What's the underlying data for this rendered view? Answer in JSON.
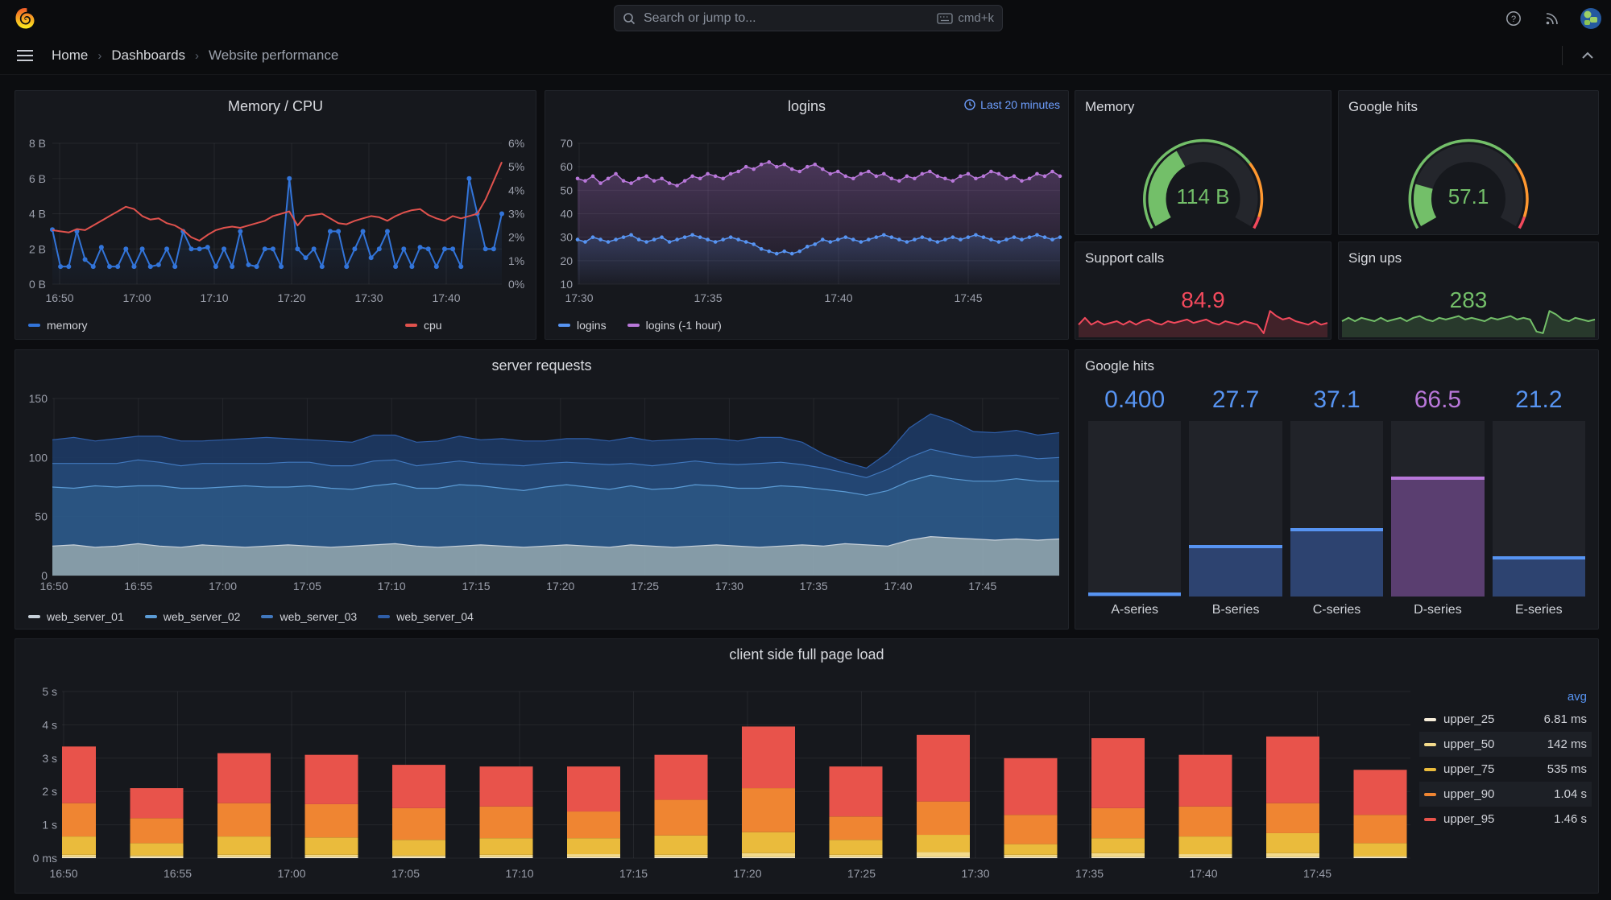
{
  "topbar": {
    "search_placeholder": "Search or jump to...",
    "shortcut": "cmd+k"
  },
  "breadcrumb": {
    "items": [
      "Home",
      "Dashboards",
      "Website performance"
    ]
  },
  "panels": {
    "memory_cpu": {
      "title": "Memory / CPU",
      "legend": [
        "memory",
        "cpu"
      ]
    },
    "logins": {
      "title": "logins",
      "time_range": "Last 20 minutes",
      "legend": [
        "logins",
        "logins (-1 hour)"
      ]
    },
    "memory_gauge": {
      "title": "Memory",
      "value": "114 B"
    },
    "google_gauge": {
      "title": "Google hits",
      "value": "57.1"
    },
    "support_calls": {
      "title": "Support calls",
      "value": "84.9"
    },
    "sign_ups": {
      "title": "Sign ups",
      "value": "283"
    },
    "server_requests": {
      "title": "server requests",
      "legend": [
        "web_server_01",
        "web_server_02",
        "web_server_03",
        "web_server_04"
      ]
    },
    "google_bars": {
      "title": "Google hits"
    },
    "client_load": {
      "title": "client side full page load",
      "legend_header": "avg"
    }
  },
  "chart_data": [
    {
      "id": "memory_cpu",
      "type": "line",
      "title": "Memory / CPU",
      "y_left_labels": [
        "8 B",
        "6 B",
        "4 B",
        "2 B",
        "0 B"
      ],
      "y_right_labels": [
        "6%",
        "5%",
        "4%",
        "3%",
        "2%",
        "1%",
        "0%"
      ],
      "x_ticks": [
        "16:50",
        "17:00",
        "17:10",
        "17:20",
        "17:30",
        "17:40"
      ],
      "ylim_left": [
        0,
        8
      ],
      "ylim_right": [
        0,
        6
      ],
      "series": [
        {
          "name": "memory",
          "axis": "left",
          "color": "#3274D9",
          "show_points": true,
          "values": [
            3.1,
            1,
            1,
            3,
            1.4,
            1,
            2.1,
            1,
            1,
            2,
            1,
            2,
            1,
            1.1,
            2,
            1,
            3,
            2,
            2,
            2.1,
            1,
            2,
            1,
            3,
            1.1,
            1,
            2,
            2,
            1,
            6,
            2,
            1.5,
            2,
            1,
            3,
            3,
            1,
            2,
            3,
            1.5,
            2,
            3,
            1,
            2,
            1,
            2.1,
            2,
            1,
            2,
            2,
            1,
            6,
            4,
            2,
            2,
            4
          ]
        },
        {
          "name": "cpu",
          "axis": "right",
          "color": "#E0524D",
          "show_points": false,
          "values": [
            2.3,
            2.25,
            2.2,
            2.35,
            2.3,
            2.5,
            2.7,
            2.9,
            3.1,
            3.3,
            3.2,
            2.9,
            2.75,
            2.8,
            2.6,
            2.5,
            2.3,
            2.0,
            1.85,
            2.1,
            2.3,
            2.4,
            2.45,
            2.4,
            2.5,
            2.6,
            2.7,
            2.9,
            3.0,
            3.1,
            2.5,
            2.9,
            2.95,
            3.0,
            2.8,
            2.6,
            2.55,
            2.7,
            2.8,
            2.9,
            2.85,
            2.7,
            2.9,
            3.05,
            3.15,
            3.2,
            2.95,
            2.8,
            2.7,
            2.9,
            2.8,
            2.9,
            3.0,
            3.6,
            4.4,
            5.2
          ]
        }
      ]
    },
    {
      "id": "logins",
      "type": "line",
      "title": "logins",
      "x_ticks": [
        "17:30",
        "17:35",
        "17:40",
        "17:45"
      ],
      "y_ticks": [
        70,
        60,
        50,
        40,
        30,
        20,
        10
      ],
      "ylim": [
        10,
        70
      ],
      "series": [
        {
          "name": "logins",
          "color": "#5794F2",
          "values": [
            29,
            28,
            30,
            29,
            28,
            29,
            30,
            31,
            29,
            28,
            29,
            30,
            28,
            29,
            30,
            31,
            30,
            29,
            28,
            29,
            30,
            29,
            28,
            27,
            25,
            24,
            23,
            24,
            23,
            24,
            26,
            27,
            29,
            28,
            29,
            30,
            29,
            28,
            29,
            30,
            31,
            30,
            29,
            28,
            29,
            30,
            29,
            28,
            29,
            30,
            29,
            30,
            31,
            30,
            29,
            28,
            29,
            30,
            29,
            30,
            31,
            30,
            29,
            30
          ]
        },
        {
          "name": "logins (-1 hour)",
          "color": "#B877D9",
          "values": [
            55,
            54,
            56,
            53,
            55,
            57,
            54,
            53,
            55,
            56,
            54,
            55,
            53,
            52,
            54,
            56,
            55,
            57,
            56,
            55,
            57,
            58,
            60,
            59,
            61,
            62,
            60,
            61,
            59,
            58,
            60,
            61,
            59,
            57,
            58,
            56,
            55,
            57,
            58,
            56,
            57,
            55,
            54,
            56,
            55,
            57,
            58,
            56,
            55,
            54,
            56,
            57,
            55,
            56,
            58,
            57,
            55,
            56,
            54,
            55,
            57,
            56,
            58,
            56
          ]
        }
      ]
    },
    {
      "id": "server_requests",
      "type": "area",
      "stacked": true,
      "title": "server requests",
      "x_ticks": [
        "16:50",
        "16:55",
        "17:00",
        "17:05",
        "17:10",
        "17:15",
        "17:20",
        "17:25",
        "17:30",
        "17:35",
        "17:40",
        "17:45"
      ],
      "y_ticks": [
        0,
        50,
        100,
        150
      ],
      "ylim": [
        0,
        150
      ],
      "series": [
        {
          "name": "web_server_01",
          "line": "#C7D0D9",
          "fill": "#8FA7B3",
          "values": [
            25,
            26,
            24,
            25,
            27,
            25,
            24,
            26,
            25,
            24,
            25,
            26,
            25,
            24,
            25,
            26,
            27,
            25,
            24,
            25,
            26,
            25,
            24,
            25,
            26,
            25,
            24,
            26,
            25,
            24,
            25,
            26,
            25,
            24,
            25,
            26,
            25,
            27,
            26,
            25,
            30,
            33,
            32,
            31,
            30,
            31,
            30,
            31
          ]
        },
        {
          "name": "web_server_02",
          "line": "#5B9BD5",
          "fill": "#2D5A8A",
          "values": [
            50,
            48,
            52,
            50,
            49,
            51,
            50,
            48,
            50,
            52,
            50,
            49,
            51,
            50,
            48,
            50,
            51,
            49,
            50,
            52,
            50,
            49,
            48,
            50,
            51,
            50,
            49,
            50,
            48,
            50,
            52,
            50,
            49,
            50,
            51,
            49,
            48,
            44,
            42,
            47,
            50,
            52,
            50,
            49,
            50,
            51,
            50,
            49
          ]
        },
        {
          "name": "web_server_03",
          "line": "#4178BE",
          "fill": "#254B7B",
          "values": [
            20,
            21,
            19,
            20,
            22,
            20,
            19,
            21,
            20,
            19,
            20,
            21,
            20,
            19,
            20,
            21,
            20,
            19,
            21,
            20,
            19,
            20,
            21,
            20,
            19,
            20,
            21,
            19,
            20,
            21,
            20,
            19,
            20,
            21,
            20,
            19,
            18,
            16,
            15,
            18,
            20,
            22,
            21,
            20,
            21,
            20,
            19,
            20
          ]
        },
        {
          "name": "web_server_04",
          "line": "#2F5EA8",
          "fill": "#1D3A63",
          "values": [
            20,
            22,
            19,
            21,
            20,
            22,
            21,
            19,
            20,
            21,
            22,
            20,
            19,
            21,
            20,
            22,
            21,
            20,
            19,
            21,
            20,
            22,
            21,
            19,
            20,
            21,
            20,
            22,
            21,
            20,
            19,
            21,
            20,
            22,
            21,
            19,
            12,
            9,
            8,
            14,
            25,
            30,
            28,
            22,
            20,
            21,
            20,
            21
          ]
        }
      ]
    },
    {
      "id": "google_bars",
      "type": "bar",
      "title": "Google hits",
      "max": 100,
      "categories": [
        "A-series",
        "B-series",
        "C-series",
        "D-series",
        "E-series"
      ],
      "values": [
        0.4,
        27.7,
        37.1,
        66.5,
        21.2
      ],
      "value_labels": [
        "0.400",
        "27.7",
        "37.1",
        "66.5",
        "21.2"
      ],
      "value_colors": [
        "#5794F2",
        "#5794F2",
        "#5794F2",
        "#B877D9",
        "#5794F2"
      ],
      "fill_colors": [
        "#2D4370",
        "#2D4370",
        "#2D4370",
        "#5A3E70",
        "#2D4370"
      ],
      "cap_colors": [
        "#5794F2",
        "#5794F2",
        "#5794F2",
        "#B877D9",
        "#5794F2"
      ]
    },
    {
      "id": "client_load",
      "type": "bar",
      "stacked": true,
      "title": "client side full page load",
      "ylim": [
        0,
        5
      ],
      "y_tick_labels": [
        "5 s",
        "4 s",
        "3 s",
        "2 s",
        "1 s",
        "0 ms"
      ],
      "x_ticks": [
        "16:50",
        "16:55",
        "17:00",
        "17:05",
        "17:10",
        "17:15",
        "17:20",
        "17:25",
        "17:30",
        "17:35",
        "17:40",
        "17:45"
      ],
      "series": [
        {
          "name": "upper_25",
          "color": "#F5ECD9",
          "avg": "6.81 ms",
          "tops": [
            0.03,
            0.03,
            0.03,
            0.03,
            0.03,
            0.03,
            0.03,
            0.03,
            0.03,
            0.03,
            0.03,
            0.03,
            0.03,
            0.03,
            0.03,
            0.03
          ]
        },
        {
          "name": "upper_50",
          "color": "#F3DA8B",
          "avg": "142 ms",
          "tops": [
            0.1,
            0.08,
            0.1,
            0.1,
            0.08,
            0.1,
            0.12,
            0.1,
            0.15,
            0.1,
            0.18,
            0.1,
            0.15,
            0.12,
            0.15,
            0.06
          ]
        },
        {
          "name": "upper_75",
          "color": "#EABB3C",
          "avg": "535 ms",
          "tops": [
            0.65,
            0.45,
            0.65,
            0.62,
            0.55,
            0.6,
            0.6,
            0.68,
            0.78,
            0.55,
            0.7,
            0.42,
            0.6,
            0.65,
            0.75,
            0.45
          ]
        },
        {
          "name": "upper_90",
          "color": "#EF8532",
          "avg": "1.04 s",
          "tops": [
            1.65,
            1.2,
            1.65,
            1.62,
            1.5,
            1.55,
            1.4,
            1.75,
            2.1,
            1.25,
            1.7,
            1.3,
            1.5,
            1.55,
            1.65,
            1.3
          ]
        },
        {
          "name": "upper_95",
          "color": "#E8534B",
          "avg": "1.46 s",
          "tops": [
            3.35,
            2.1,
            3.15,
            3.1,
            2.8,
            2.75,
            2.75,
            3.1,
            3.95,
            2.75,
            3.7,
            3.0,
            3.6,
            3.1,
            3.65,
            2.65
          ]
        }
      ]
    },
    {
      "id": "memory_gauge",
      "type": "gauge",
      "title": "Memory",
      "value": 114,
      "display": "114 B",
      "min": 0,
      "max": 300,
      "color": "#73BF69",
      "thresholds": [
        {
          "to": 0.72,
          "color": "#73BF69"
        },
        {
          "to": 0.95,
          "color": "#FF9830"
        },
        {
          "to": 1,
          "color": "#F2495C"
        }
      ]
    },
    {
      "id": "google_gauge",
      "type": "gauge",
      "title": "Google hits",
      "value": 57.1,
      "display": "57.1",
      "min": 0,
      "max": 300,
      "color": "#73BF69",
      "thresholds": [
        {
          "to": 0.72,
          "color": "#73BF69"
        },
        {
          "to": 0.95,
          "color": "#FF9830"
        },
        {
          "to": 1,
          "color": "#F2495C"
        }
      ]
    },
    {
      "id": "support_calls",
      "type": "sparkline",
      "title": "Support calls",
      "display": "84.9",
      "color": "#F2495C",
      "values": [
        3,
        5,
        3,
        4,
        3,
        3.5,
        4,
        3,
        4,
        3,
        4,
        4.5,
        3.5,
        3,
        4,
        3.5,
        4,
        4.5,
        3.5,
        4,
        4.5,
        3.5,
        3,
        4,
        3.5,
        3,
        4,
        3.5,
        3,
        0.5,
        7,
        5.5,
        4.5,
        5,
        4,
        3.5,
        3,
        4,
        3,
        3.5
      ]
    },
    {
      "id": "sign_ups",
      "type": "sparkline",
      "title": "Sign ups",
      "display": "283",
      "color": "#73BF69",
      "values": [
        4,
        5,
        4,
        5,
        4.5,
        4,
        5,
        4,
        4.5,
        5,
        4,
        5,
        5.5,
        4.5,
        4,
        5,
        4.5,
        5,
        5.5,
        4.5,
        5,
        4.5,
        4,
        5,
        4.5,
        5,
        5.5,
        4.5,
        5,
        4.5,
        1,
        0.5,
        7,
        6,
        4.5,
        4,
        5,
        4.5,
        4,
        4.5
      ]
    }
  ]
}
